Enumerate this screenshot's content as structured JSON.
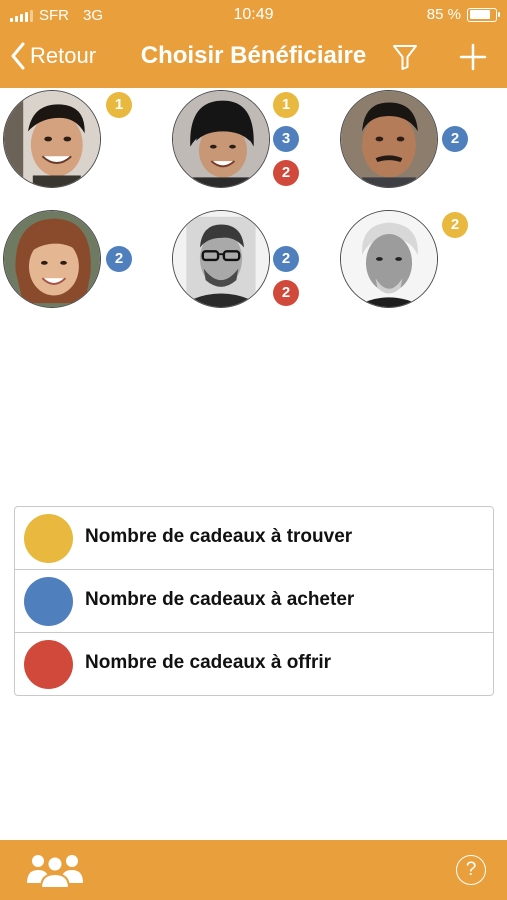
{
  "status_bar": {
    "carrier": "SFR",
    "network": "3G",
    "time": "10:49",
    "battery_text": "85 %",
    "battery_level": 0.85,
    "icons": [
      "signal-bars-icon",
      "battery-icon"
    ]
  },
  "nav": {
    "back_label": "Retour",
    "title": "Choisir Bénéficiaire",
    "icons": [
      "chevron-left-icon",
      "filter-icon",
      "plus-icon"
    ]
  },
  "colors": {
    "header": "#e9a03c",
    "to_find": "#e8b83f",
    "to_buy": "#4f7fbd",
    "to_give": "#d1493a"
  },
  "beneficiaries": [
    {
      "photo": "smiling young man with dark hair",
      "badges": [
        {
          "value": "1",
          "kind": "to_find"
        }
      ]
    },
    {
      "photo": "smiling woman in black beanie",
      "badges": [
        {
          "value": "1",
          "kind": "to_find"
        },
        {
          "value": "3",
          "kind": "to_buy"
        },
        {
          "value": "2",
          "kind": "to_give"
        }
      ]
    },
    {
      "photo": "middle-aged man with mustache",
      "badges": [
        {
          "value": "2",
          "kind": "to_buy"
        }
      ]
    },
    {
      "photo": "smiling woman with brown hair",
      "badges": [
        {
          "value": "2",
          "kind": "to_buy"
        }
      ]
    },
    {
      "photo": "bearded man with glasses, black and white",
      "badges": [
        {
          "value": "2",
          "kind": "to_buy"
        },
        {
          "value": "2",
          "kind": "to_give"
        }
      ]
    },
    {
      "photo": "older man with white hair, black and white",
      "badges": [
        {
          "value": "2",
          "kind": "to_find"
        }
      ]
    }
  ],
  "legend": [
    {
      "kind": "to_find",
      "label": "Nombre de cadeaux à trouver"
    },
    {
      "kind": "to_buy",
      "label": "Nombre de cadeaux à acheter"
    },
    {
      "kind": "to_give",
      "label": "Nombre de cadeaux à offrir"
    }
  ],
  "tab_bar": {
    "help_label": "?",
    "icons": [
      "people-group-icon",
      "help-icon"
    ]
  }
}
